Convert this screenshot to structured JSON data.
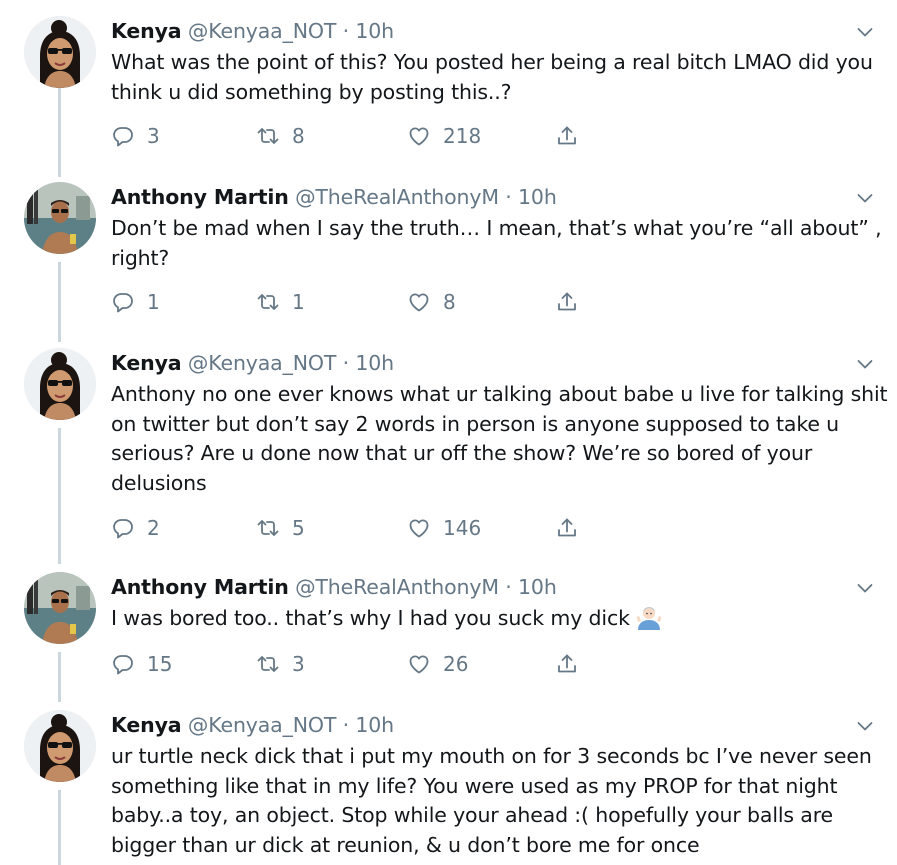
{
  "tweets": [
    {
      "author": "kenya",
      "name": "Kenya",
      "handle": "@Kenyaa_NOT",
      "separator": "·",
      "time": "10h",
      "lines": [
        "What was the point of this? You posted her being a real bitch LMAO did you",
        "think u did something by posting this..?"
      ],
      "replies": "3",
      "retweets": "8",
      "likes": "218"
    },
    {
      "author": "anthony",
      "name": "Anthony Martin",
      "handle": "@TheRealAnthonyM",
      "separator": "·",
      "time": "10h",
      "lines": [
        "Don’t be mad when I say the truth… I mean, that’s what you’re “all about” ,",
        "right?"
      ],
      "replies": "1",
      "retweets": "1",
      "likes": "8"
    },
    {
      "author": "kenya",
      "name": "Kenya",
      "handle": "@Kenyaa_NOT",
      "separator": "·",
      "time": "10h",
      "lines": [
        "Anthony no one ever knows what ur talking about babe u live for talking shit",
        "on twitter but don’t say 2 words in person is anyone supposed to take u",
        "serious? Are u done now that ur off the show? We’re so bored of your",
        "delusions"
      ],
      "replies": "2",
      "retweets": "5",
      "likes": "146"
    },
    {
      "author": "anthony",
      "name": "Anthony Martin",
      "handle": "@TheRealAnthonyM",
      "separator": "·",
      "time": "10h",
      "lines": [
        "I was bored too.. that’s why I had you suck my dick"
      ],
      "emoji": "person-shrugging-emoji",
      "replies": "15",
      "retweets": "3",
      "likes": "26"
    },
    {
      "author": "kenya",
      "name": "Kenya",
      "handle": "@Kenyaa_NOT",
      "separator": "·",
      "time": "10h",
      "lines": [
        "ur turtle neck dick that i put my mouth on for 3 seconds bc I’ve never seen",
        "something like that in my life? You were used as my PROP for that night",
        "baby..a toy, an object. Stop while your ahead :( hopefully your balls are",
        "bigger than ur dick at reunion, & u don’t bore me for once"
      ]
    }
  ],
  "icons": {
    "reply": "reply-icon",
    "retweet": "retweet-icon",
    "like": "heart-icon",
    "share": "share-icon",
    "menu": "chevron-down-icon"
  },
  "colors": {
    "text": "#14171a",
    "secondary": "#657786",
    "thread_line": "#ccd6dd"
  }
}
